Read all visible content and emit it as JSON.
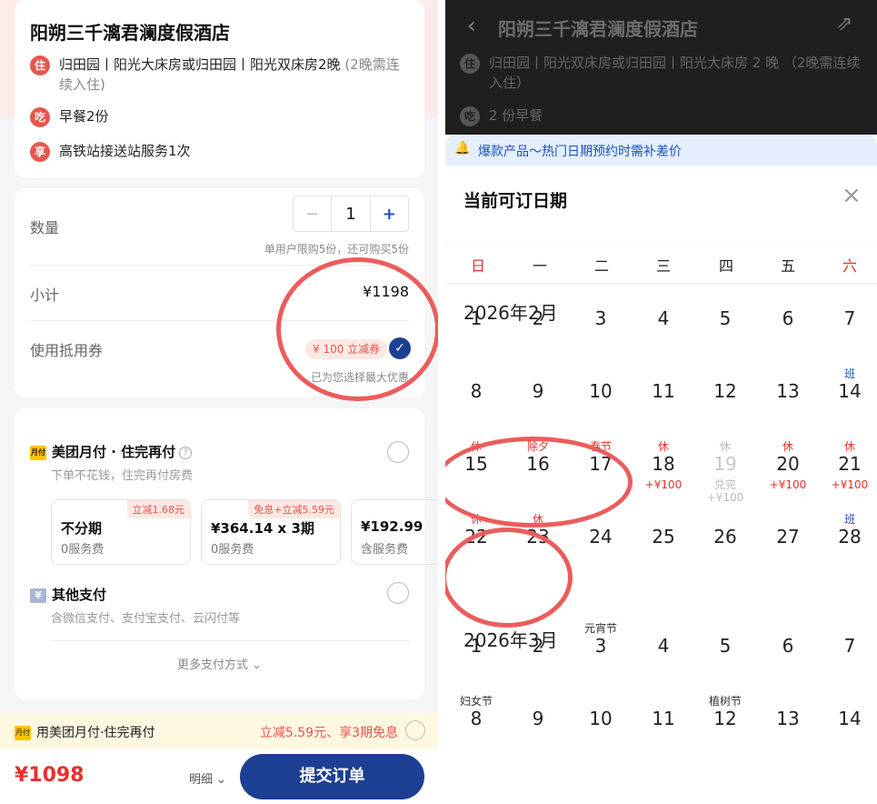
{
  "order": {
    "hotel_name": "阳朔三千漓君澜度假酒店",
    "items": [
      {
        "badge": "住",
        "text": "归田园丨阳光大床房或归田园丨阳光双床房2晚",
        "note": "(2晚需连续入住)"
      },
      {
        "badge": "吃",
        "text": "早餐2份",
        "note": ""
      },
      {
        "badge": "享",
        "text": "高铁站接送站服务1次",
        "note": ""
      }
    ],
    "quantity_label": "数量",
    "quantity_value": "1",
    "minus": "−",
    "plus": "+",
    "quantity_hint": "单用户限购5份，还可购买5份",
    "subtotal_label": "小计",
    "subtotal_value": "¥1198",
    "coupon_label": "使用抵用券",
    "coupon_tag": "¥ 100 立减券",
    "coupon_check": "✓",
    "coupon_hint": "已为您选择最大优惠"
  },
  "payment": {
    "monthly": {
      "icon_text": "月付",
      "title": "美团月付 · 住完再付",
      "help": "?",
      "subtitle": "下单不花钱，住完再付房费",
      "plans": [
        {
          "tag": "立减1.68元",
          "main": "不分期",
          "fee": "0服务费"
        },
        {
          "tag": "免息+立减5.59元",
          "main": "¥364.14 x 3期",
          "fee": "0服务费"
        },
        {
          "tag": "",
          "main": "¥192.99",
          "fee": "含服务费"
        }
      ]
    },
    "other": {
      "icon_text": "¥",
      "title": "其他支付",
      "subtitle": "含微信支付、支付宝支付、云闪付等"
    },
    "more": "更多支付方式 ⌄"
  },
  "promo_bar": {
    "icon_text": "月付",
    "left": "用美团月付·住完再付",
    "right": "立减5.59元、享3期免息"
  },
  "bottom": {
    "total": "¥1098",
    "detail": "明细 ⌄",
    "submit": "提交订单"
  },
  "calendar_screen": {
    "back": "‹",
    "title": "阳朔三千漓君澜度假酒店",
    "share": "⇗",
    "lines": [
      {
        "badge": "住",
        "text": "归田园丨阳光双床房或归田园丨阳光大床房 2 晚 （2晚需连续入住）"
      },
      {
        "badge": "吃",
        "text": "2 份早餐"
      }
    ],
    "notice": "爆款产品～热门日期预约时需补差价",
    "bell": "🔔",
    "sheet_title": "当前可订日期",
    "close": "×",
    "weekdays": [
      "日",
      "一",
      "二",
      "三",
      "四",
      "五",
      "六"
    ],
    "months": [
      {
        "label": "2026年2月",
        "weeks": [
          [
            {
              "num": "1",
              "top": "",
              "bottom": ""
            },
            {
              "num": "2",
              "top": "",
              "bottom": ""
            },
            {
              "num": "3",
              "top": "",
              "bottom": ""
            },
            {
              "num": "4",
              "top": "",
              "bottom": ""
            },
            {
              "num": "5",
              "top": "",
              "bottom": ""
            },
            {
              "num": "6",
              "top": "",
              "bottom": ""
            },
            {
              "num": "7",
              "top": "",
              "bottom": ""
            }
          ],
          [
            {
              "num": "8",
              "top": "",
              "bottom": ""
            },
            {
              "num": "9",
              "top": "",
              "bottom": ""
            },
            {
              "num": "10",
              "top": "",
              "bottom": ""
            },
            {
              "num": "11",
              "top": "",
              "bottom": ""
            },
            {
              "num": "12",
              "top": "",
              "bottom": ""
            },
            {
              "num": "13",
              "top": "",
              "bottom": ""
            },
            {
              "num": "14",
              "top": "班",
              "top_style": "blue",
              "bottom": ""
            }
          ],
          [
            {
              "num": "15",
              "top": "休",
              "top_style": "red",
              "bottom": ""
            },
            {
              "num": "16",
              "top": "除夕",
              "top_style": "red",
              "bottom": ""
            },
            {
              "num": "17",
              "top": "春节",
              "top_style": "red",
              "bottom": ""
            },
            {
              "num": "18",
              "top": "休",
              "top_style": "red",
              "bottom": "+¥100"
            },
            {
              "num": "19",
              "top": "休",
              "top_style": "gray",
              "bottom": "兑完\n+¥100",
              "disabled": true
            },
            {
              "num": "20",
              "top": "休",
              "top_style": "red",
              "bottom": "+¥100"
            },
            {
              "num": "21",
              "top": "休",
              "top_style": "red",
              "bottom": "+¥100"
            }
          ],
          [
            {
              "num": "22",
              "top": "休",
              "top_style": "red",
              "bottom": ""
            },
            {
              "num": "23",
              "top": "休",
              "top_style": "red",
              "bottom": ""
            },
            {
              "num": "24",
              "top": "",
              "bottom": ""
            },
            {
              "num": "25",
              "top": "",
              "bottom": ""
            },
            {
              "num": "26",
              "top": "",
              "bottom": ""
            },
            {
              "num": "27",
              "top": "",
              "bottom": ""
            },
            {
              "num": "28",
              "top": "班",
              "top_style": "blue",
              "bottom": ""
            }
          ]
        ]
      },
      {
        "label": "2026年3月",
        "weeks": [
          [
            {
              "num": "1",
              "top": "",
              "bottom": ""
            },
            {
              "num": "2",
              "top": "",
              "bottom": ""
            },
            {
              "num": "3",
              "top": "元宵节",
              "top_style": "dark",
              "bottom": ""
            },
            {
              "num": "4",
              "top": "",
              "bottom": ""
            },
            {
              "num": "5",
              "top": "",
              "bottom": ""
            },
            {
              "num": "6",
              "top": "",
              "bottom": ""
            },
            {
              "num": "7",
              "top": "",
              "bottom": ""
            }
          ],
          [
            {
              "num": "8",
              "top": "妇女节",
              "top_style": "dark",
              "bottom": ""
            },
            {
              "num": "9",
              "top": "",
              "bottom": ""
            },
            {
              "num": "10",
              "top": "",
              "bottom": ""
            },
            {
              "num": "11",
              "top": "",
              "bottom": ""
            },
            {
              "num": "12",
              "top": "植树节",
              "top_style": "dark",
              "bottom": ""
            },
            {
              "num": "13",
              "top": "",
              "bottom": ""
            },
            {
              "num": "14",
              "top": "",
              "bottom": ""
            }
          ]
        ]
      }
    ]
  },
  "colors": {
    "brand_blue": "#1c3f94",
    "price_red": "#e8302b",
    "highlight_ring": "#ec5c5c",
    "holiday_red": "#e8302b",
    "workday_blue": "#1c4fbf"
  }
}
